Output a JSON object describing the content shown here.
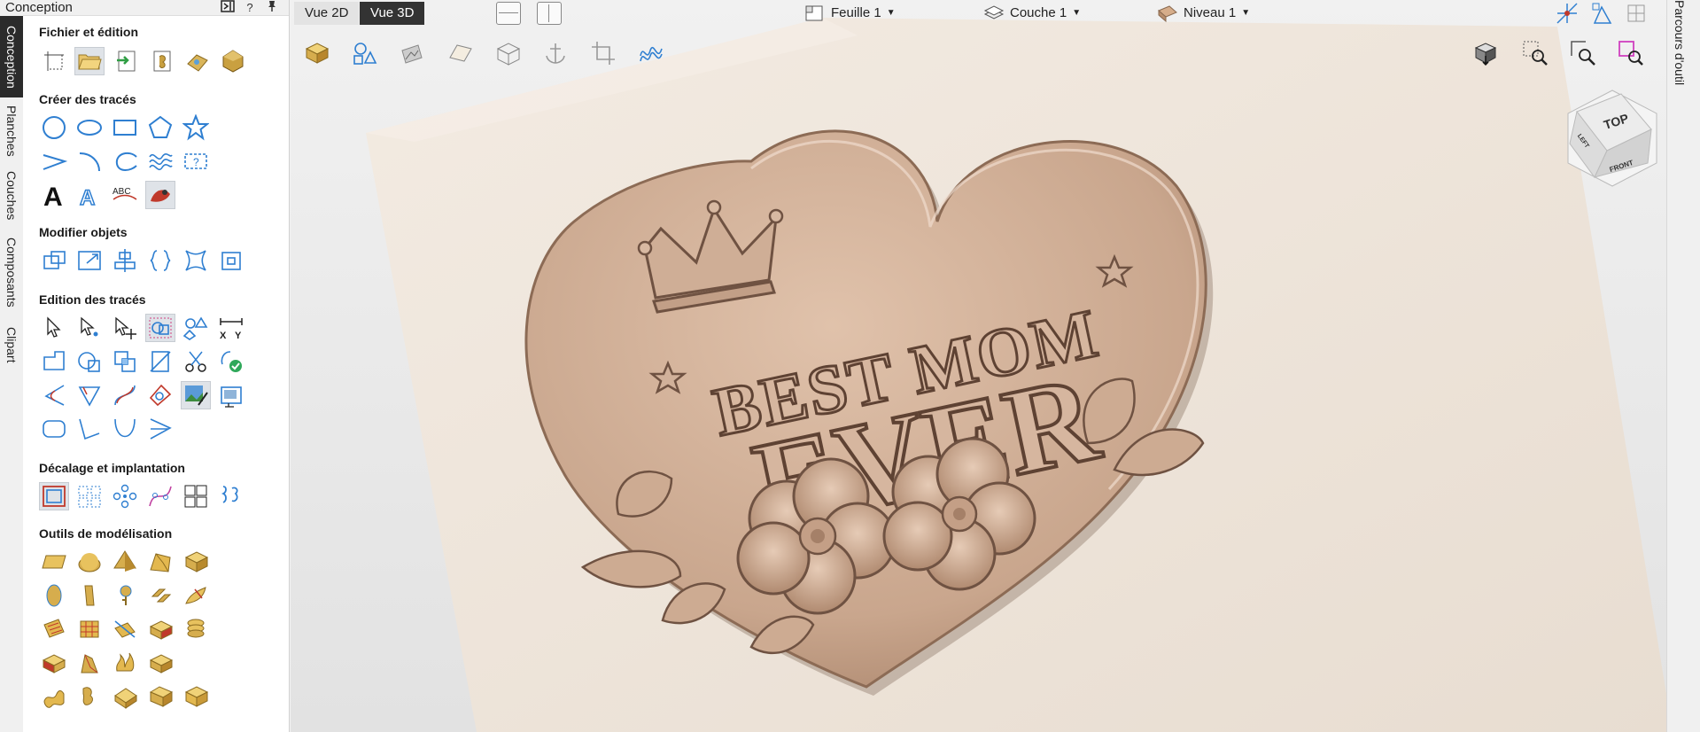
{
  "vertical_tabs": [
    "Conception",
    "Planches",
    "Couches",
    "Composants",
    "Clipart"
  ],
  "panel": {
    "title": "Conception",
    "help_label": "?",
    "sections": {
      "file": "Fichier et édition",
      "create": "Créer des tracés",
      "modify": "Modifier objets",
      "edit": "Edition des tracés",
      "offset": "Décalage et implantation",
      "modeling": "Outils de modélisation"
    }
  },
  "toolbar": {
    "view2d": "Vue 2D",
    "view3d": "Vue 3D",
    "sheet": "Feuille 1",
    "layer": "Couche 1",
    "level": "Niveau 1"
  },
  "view_cube": {
    "top": "TOP",
    "front": "FRONT",
    "left": "LEFT"
  },
  "model": {
    "line1": "BEST MOM",
    "line2": "EVER"
  },
  "right_tab": "Parcours d'outil",
  "icon_text": {
    "text_big": "A",
    "abc": "ABC",
    "xy_x": "X",
    "xy_y": "Y"
  },
  "colors": {
    "accent": "#2f7fd1",
    "model": "#c9a78e",
    "wood": "#efe6dc"
  }
}
